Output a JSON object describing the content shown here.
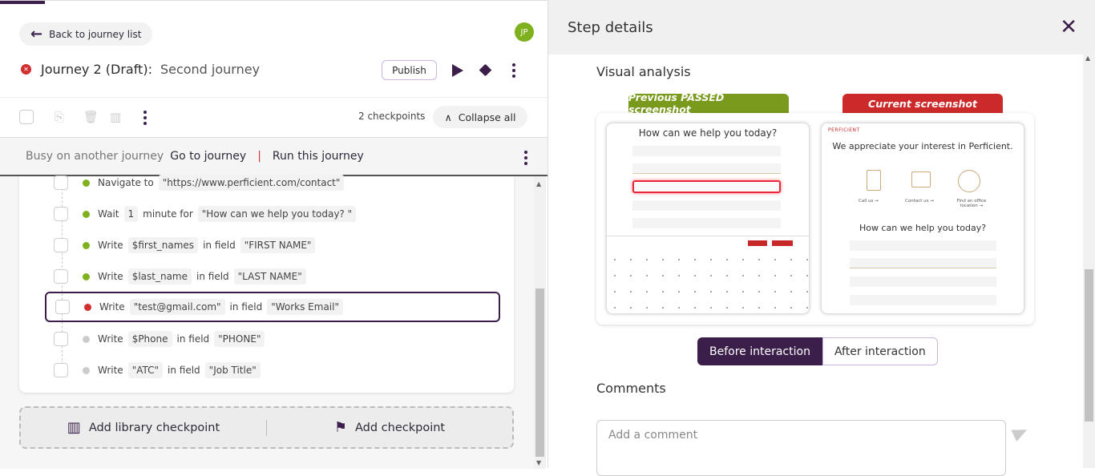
{
  "header": {
    "back_label": "Back to journey list",
    "avatar_initials": "JP",
    "journey_title": "Journey 2 (Draft):",
    "journey_name": "Second journey",
    "publish_label": "Publish"
  },
  "toolbar": {
    "checkpoint_count": "2 checkpoints",
    "collapse_label": "Collapse all"
  },
  "busy_bar": {
    "status": "Busy on another journey",
    "go_label": "Go to journey",
    "separator": "|",
    "run_label": "Run this journey"
  },
  "colors": {
    "passed": "#7fb01e",
    "failed": "#d32f2f",
    "pending": "#cccccc",
    "accent": "#3b1f4a"
  },
  "steps": [
    {
      "status": "passed",
      "parts": [
        {
          "t": "Navigate to",
          "c": false
        },
        {
          "t": "\"https://www.perficient.com/contact\"",
          "c": true
        }
      ]
    },
    {
      "status": "passed",
      "parts": [
        {
          "t": "Wait",
          "c": false
        },
        {
          "t": "1",
          "c": true
        },
        {
          "t": "minute for",
          "c": false
        },
        {
          "t": "\"How can we help you today? \"",
          "c": true
        }
      ]
    },
    {
      "status": "passed",
      "parts": [
        {
          "t": "Write",
          "c": false
        },
        {
          "t": "$first_names",
          "c": true
        },
        {
          "t": "in field",
          "c": false
        },
        {
          "t": "\"FIRST NAME\"",
          "c": true
        }
      ]
    },
    {
      "status": "passed",
      "parts": [
        {
          "t": "Write",
          "c": false
        },
        {
          "t": "$last_name",
          "c": true
        },
        {
          "t": "in field",
          "c": false
        },
        {
          "t": "\"LAST NAME\"",
          "c": true
        }
      ]
    },
    {
      "status": "failed",
      "selected": true,
      "parts": [
        {
          "t": "Write",
          "c": false
        },
        {
          "t": "\"test@gmail.com\"",
          "c": true
        },
        {
          "t": "in field",
          "c": false
        },
        {
          "t": "\"Works Email\"",
          "c": true
        }
      ]
    },
    {
      "status": "pending",
      "parts": [
        {
          "t": "Write",
          "c": false
        },
        {
          "t": "$Phone",
          "c": true
        },
        {
          "t": "in field",
          "c": false
        },
        {
          "t": "\"PHONE\"",
          "c": true
        }
      ]
    },
    {
      "status": "pending",
      "parts": [
        {
          "t": "Write",
          "c": false
        },
        {
          "t": "\"ATC\"",
          "c": true
        },
        {
          "t": "in field",
          "c": false
        },
        {
          "t": "\"Job Title\"",
          "c": true
        }
      ]
    }
  ],
  "add": {
    "library_label": "Add library checkpoint",
    "checkpoint_label": "Add checkpoint"
  },
  "details": {
    "title": "Step details",
    "visual_heading": "Visual analysis",
    "previous_label": "Previous PASSED screenshot",
    "current_label": "Current screenshot",
    "prev_shot": {
      "heading": "How can we help you today?"
    },
    "cur_shot": {
      "logo": "PERFICIENT",
      "heading": "We appreciate your interest in Perficient.",
      "call": "Call us →",
      "contact": "Contact us →",
      "office": "Find an office location →",
      "form_heading": "How can we help you today?"
    },
    "before_label": "Before interaction",
    "after_label": "After interaction",
    "comments_heading": "Comments",
    "comment_placeholder": "Add a comment"
  }
}
